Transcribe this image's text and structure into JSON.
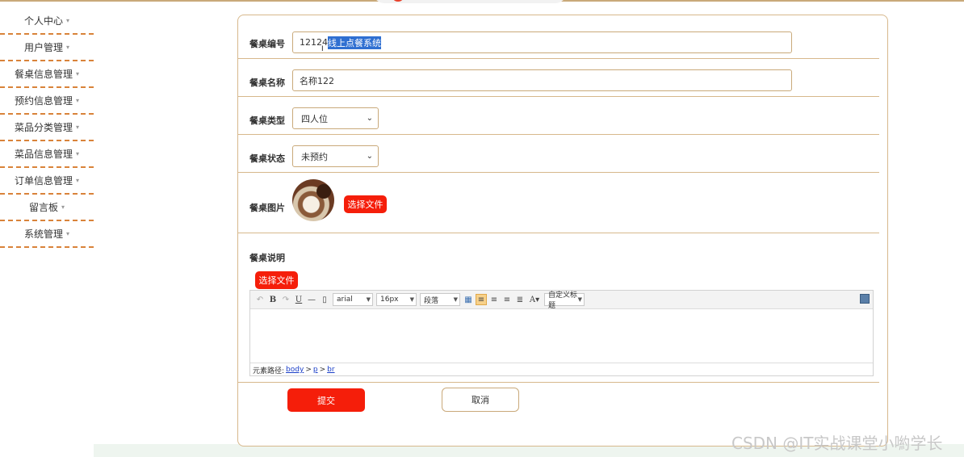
{
  "sidebar": {
    "items": [
      {
        "label": "个人中心"
      },
      {
        "label": "用户管理"
      },
      {
        "label": "餐桌信息管理"
      },
      {
        "label": "预约信息管理"
      },
      {
        "label": "菜品分类管理"
      },
      {
        "label": "菜品信息管理"
      },
      {
        "label": "订单信息管理"
      },
      {
        "label": "留言板"
      },
      {
        "label": "系统管理"
      }
    ],
    "caret": "▾"
  },
  "form": {
    "table_no_label": "餐桌编号",
    "table_no_value_plain": "12124",
    "table_no_value_selected": "线上点餐系统",
    "table_name_label": "餐桌名称",
    "table_name_value": "名称122",
    "table_type_label": "餐桌类型",
    "table_type_value": "四人位",
    "table_status_label": "餐桌状态",
    "table_status_value": "未预约",
    "table_image_label": "餐桌图片",
    "choose_file": "选择文件",
    "table_desc_label": "餐桌说明",
    "submit": "提交",
    "cancel": "取消"
  },
  "editor": {
    "font": "arial",
    "size": "16px",
    "paragraph": "段落",
    "custom_title": "自定义标题",
    "path_label": "元素路径:",
    "path": [
      "body",
      "p",
      "br"
    ]
  },
  "watermark": "CSDN @IT实战课堂小喲学长",
  "colors": {
    "accent_red": "#f51e0a",
    "border_tan": "#c9a97a",
    "divider": "#d9833a"
  }
}
